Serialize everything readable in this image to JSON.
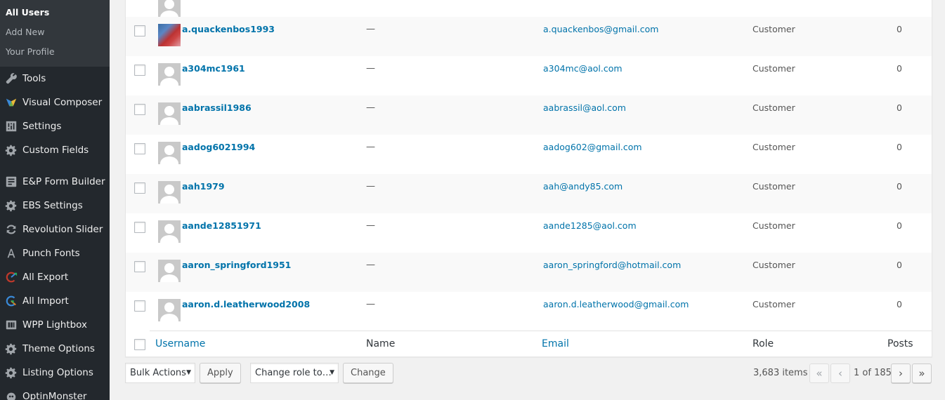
{
  "sidebar": {
    "submenu": [
      {
        "label": "All Users",
        "current": true
      },
      {
        "label": "Add New",
        "current": false
      },
      {
        "label": "Your Profile",
        "current": false
      }
    ],
    "menu": [
      {
        "label": "Tools",
        "icon": "wrench-icon"
      },
      {
        "label": "Visual Composer",
        "icon": "visual-composer-icon"
      },
      {
        "label": "Settings",
        "icon": "settings-sliders-icon"
      },
      {
        "label": "Custom Fields",
        "icon": "gear-icon"
      },
      {
        "label": "E&P Form Builder",
        "icon": "form-icon"
      },
      {
        "label": "EBS Settings",
        "icon": "gear-icon"
      },
      {
        "label": "Revolution Slider",
        "icon": "refresh-icon"
      },
      {
        "label": "Punch Fonts",
        "icon": "font-a-icon"
      },
      {
        "label": "All Export",
        "icon": "export-icon"
      },
      {
        "label": "All Import",
        "icon": "import-icon"
      },
      {
        "label": "WPP Lightbox",
        "icon": "lightbox-icon"
      },
      {
        "label": "Theme Options",
        "icon": "gear-icon"
      },
      {
        "label": "Listing Options",
        "icon": "gear-icon"
      },
      {
        "label": "OptinMonster",
        "icon": "monster-icon"
      }
    ]
  },
  "users": [
    {
      "username": "a.quackenbos1993",
      "name": "—",
      "email": "a.quackenbos@gmail.com",
      "role": "Customer",
      "posts": "0",
      "photo": true
    },
    {
      "username": "a304mc1961",
      "name": "—",
      "email": "a304mc@aol.com",
      "role": "Customer",
      "posts": "0",
      "photo": false
    },
    {
      "username": "aabrassil1986",
      "name": "—",
      "email": "aabrassil@aol.com",
      "role": "Customer",
      "posts": "0",
      "photo": false
    },
    {
      "username": "aadog6021994",
      "name": "—",
      "email": "aadog602@gmail.com",
      "role": "Customer",
      "posts": "0",
      "photo": false
    },
    {
      "username": "aah1979",
      "name": "—",
      "email": "aah@andy85.com",
      "role": "Customer",
      "posts": "0",
      "photo": false
    },
    {
      "username": "aande12851971",
      "name": "—",
      "email": "aande1285@aol.com",
      "role": "Customer",
      "posts": "0",
      "photo": false
    },
    {
      "username": "aaron_springford1951",
      "name": "—",
      "email": "aaron_springford@hotmail.com",
      "role": "Customer",
      "posts": "0",
      "photo": false
    },
    {
      "username": "aaron.d.leatherwood2008",
      "name": "—",
      "email": "aaron.d.leatherwood@gmail.com",
      "role": "Customer",
      "posts": "0",
      "photo": false
    }
  ],
  "columns": {
    "username": "Username",
    "name": "Name",
    "email": "Email",
    "role": "Role",
    "posts": "Posts"
  },
  "toolbar": {
    "bulk_actions": "Bulk Actions",
    "apply": "Apply",
    "change_role": "Change role to…",
    "change": "Change"
  },
  "pagination": {
    "items": "3,683 items",
    "first": "«",
    "prev": "‹",
    "page_text": "1 of 185",
    "next": "›",
    "last": "»"
  },
  "colors": {
    "sidebar_bg": "#23282d",
    "submenu_bg": "#32373c",
    "link": "#0073aa"
  }
}
